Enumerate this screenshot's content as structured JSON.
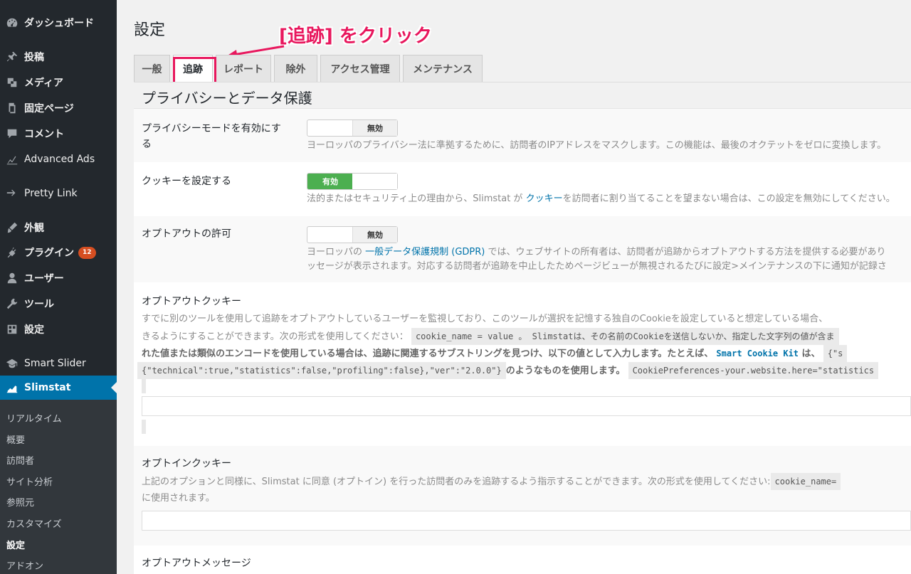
{
  "sidebar": {
    "items": [
      {
        "label": "ダッシュボード",
        "icon": "dashboard-icon"
      },
      {
        "label": "投稿",
        "icon": "pushpin-icon"
      },
      {
        "label": "メディア",
        "icon": "media-icon"
      },
      {
        "label": "固定ページ",
        "icon": "page-icon"
      },
      {
        "label": "コメント",
        "icon": "comment-icon"
      },
      {
        "label": "Advanced Ads",
        "icon": "chart-icon"
      },
      {
        "label": "Pretty Link",
        "icon": "link-icon"
      },
      {
        "label": "外観",
        "icon": "brush-icon"
      },
      {
        "label": "プラグイン",
        "icon": "plugin-icon",
        "badge": "12"
      },
      {
        "label": "ユーザー",
        "icon": "user-icon"
      },
      {
        "label": "ツール",
        "icon": "wrench-icon"
      },
      {
        "label": "設定",
        "icon": "settings-icon"
      },
      {
        "label": "Smart Slider",
        "icon": "graduation-icon"
      },
      {
        "label": "Slimstat",
        "icon": "slimstat-icon"
      }
    ],
    "submenu": [
      "リアルタイム",
      "概要",
      "訪問者",
      "サイト分析",
      "参照元",
      "カスタマイズ",
      "設定",
      "アドオン"
    ]
  },
  "main": {
    "title": "設定",
    "annotation": "[追跡] をクリック",
    "tabs": [
      "一般",
      "追跡",
      "レポート",
      "除外",
      "アクセス管理",
      "メンテナンス"
    ],
    "section_title": "プライバシーとデータ保護",
    "privacy_mode": {
      "label_line1": "プライバシーモードを有効にす",
      "label_line2": "る",
      "toggle_off": "無効",
      "desc": "ヨーロッパのプライバシー法に準拠するために、訪問者のIPアドレスをマスクします。この機能は、最後のオクテットをゼロに変換します。"
    },
    "cookie": {
      "label": "クッキーを設定する",
      "toggle_on": "有効",
      "desc_pre": "法的またはセキュリティ上の理由から、Slimstat が ",
      "desc_link": "クッキー",
      "desc_post": "を訪問者に割り当てることを望まない場合は、この設定を無効にしてください。"
    },
    "optout": {
      "label": "オプトアウトの許可",
      "toggle_off": "無効",
      "desc1_pre": "ヨーロッパの ",
      "desc1_link": "一般データ保護規制 (GDPR)",
      "desc1_post": " では、ウェブサイトの所有者は、訪問者が追跡からオプトアウトする方法を提供する必要があり",
      "desc2": "ッセージが表示されます。対応する訪問者が追跡を中止したためページビューが無視されるたびに設定>メインテナンスの下に通知が記録さ"
    },
    "optout_cookie": {
      "label": "オプトアウトクッキー",
      "line1": "すでに別のツールを使用して追跡をオプトアウトしているユーザーを監視しており、このツールが選択を記憶する独自のCookieを設定していると想定している場合、",
      "line2_pre": "きるようにすることができます。次の形式を使用してください：",
      "line2_code": "cookie_name = value 。 Slimstatは、その名前のCookieを送信しないか、指定した文字列の値が含ま",
      "line3_pre": "れた値または類似のエンコードを使用している場合は、追跡に関連するサブストリングを見つけ、以下の値として入力します。たとえば、",
      "line3_link": "Smart Cookie Kit",
      "line3_mid": " は、",
      "line3_code": "{\"s",
      "line4_code1": "{\"technical\":true,\"statistics\":false,\"profiling\":false},\"ver\":\"2.0.0\"}",
      "line4_mid": "のようなものを使用します。",
      "line4_code2": "CookiePreferences-your.website.here=\"statistics"
    },
    "optin_cookie": {
      "label": "オプトインクッキー",
      "line1_pre": "上記のオプションと同様に、Slimstat に同意 (オプトイン) を行った訪問者のみを追跡するよう指示することができます。次の形式を使用してください:",
      "line1_code": "cookie_name=",
      "line2": "に使用されます。"
    },
    "optout_message": {
      "label": "オプトアウトメッセージ"
    }
  },
  "colors": {
    "sidebar_bg": "#23282d",
    "active_bg": "#0073aa",
    "annotation": "#e8175d",
    "toggle_on": "#4caf50",
    "badge": "#d54e21"
  }
}
